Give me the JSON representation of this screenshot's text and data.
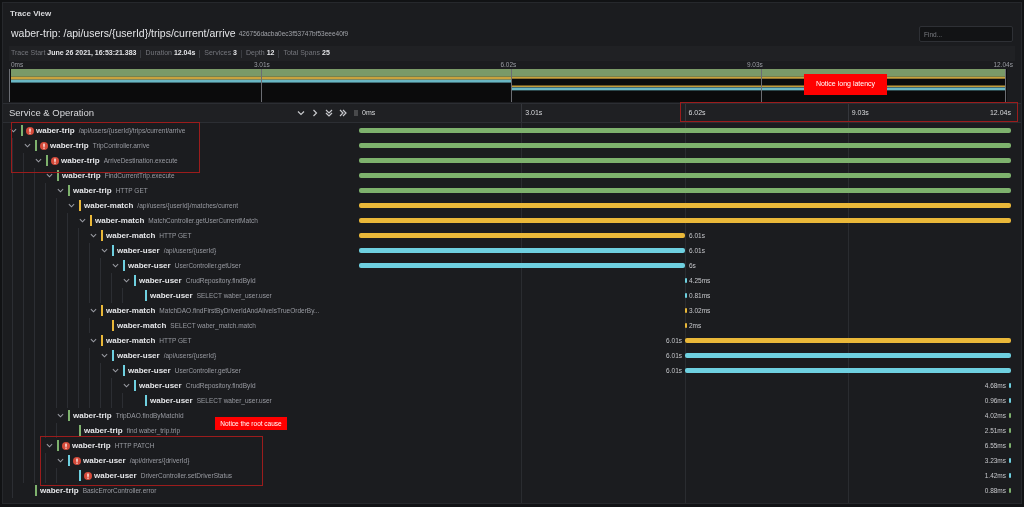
{
  "panel_title": "Trace View",
  "trace": {
    "title": "waber-trip: /api/users/{userId}/trips/current/arrive",
    "trace_id": "426756dacba0ec3f53747bf53eee40f9"
  },
  "find": {
    "placeholder": "Find..."
  },
  "meta": [
    {
      "label": "Trace Start",
      "value": "June 26 2021, 16:53:21.383"
    },
    {
      "label": "Duration",
      "value": "12.04s"
    },
    {
      "label": "Services",
      "value": "3"
    },
    {
      "label": "Depth",
      "value": "12"
    },
    {
      "label": "Total Spans",
      "value": "25"
    }
  ],
  "minimap": {
    "ticks": [
      "0ms",
      "3.01s",
      "6.02s",
      "9.03s",
      "12.04s"
    ]
  },
  "annotations": [
    {
      "text": "Notice long latency"
    },
    {
      "text": "Notice the root cause"
    }
  ],
  "columns": {
    "title": "Service & Operation",
    "ticks": [
      "0ms",
      "3.01s",
      "6.02s",
      "9.03s",
      "12.04s"
    ]
  },
  "spans": [
    {
      "service": "waber-trip",
      "operation": "/api/users/{userId}/trips/current/arrive",
      "error": true,
      "expanded": true,
      "color": "#7eb26d",
      "kind": "full",
      "children": [
        {
          "service": "waber-trip",
          "operation": "TripController.arrive",
          "error": true,
          "expanded": true,
          "color": "#7eb26d",
          "kind": "full",
          "children": [
            {
              "service": "waber-trip",
              "operation": "ArriveDestination.execute",
              "error": true,
              "expanded": true,
              "color": "#7eb26d",
              "kind": "full",
              "children": [
                {
                  "service": "waber-trip",
                  "operation": "FindCurrentTrip.execute",
                  "error": false,
                  "expanded": true,
                  "color": "#7eb26d",
                  "kind": "full",
                  "children": [
                    {
                      "service": "waber-trip",
                      "operation": "HTTP GET",
                      "error": false,
                      "expanded": true,
                      "color": "#7eb26d",
                      "kind": "full",
                      "children": [
                        {
                          "service": "waber-match",
                          "operation": "/api/users/{userId}/matches/current",
                          "error": false,
                          "expanded": true,
                          "color": "#eab839",
                          "kind": "full",
                          "children": [
                            {
                              "service": "waber-match",
                              "operation": "MatchController.getUserCurrentMatch",
                              "error": false,
                              "expanded": true,
                              "color": "#eab839",
                              "kind": "full",
                              "children": [
                                {
                                  "service": "waber-match",
                                  "operation": "HTTP GET",
                                  "error": false,
                                  "expanded": true,
                                  "color": "#eab839",
                                  "kind": "early",
                                  "duration": "6.01s",
                                  "children": [
                                    {
                                      "service": "waber-user",
                                      "operation": "/api/users/{userId}",
                                      "error": false,
                                      "expanded": true,
                                      "color": "#6ed0e0",
                                      "kind": "early",
                                      "duration": "6.01s",
                                      "children": [
                                        {
                                          "service": "waber-user",
                                          "operation": "UserController.getUser",
                                          "error": false,
                                          "expanded": true,
                                          "color": "#6ed0e0",
                                          "kind": "early",
                                          "duration": "6s",
                                          "children": [
                                            {
                                              "service": "waber-user",
                                              "operation": "CrudRepository.findById",
                                              "error": false,
                                              "expanded": true,
                                              "color": "#6ed0e0",
                                              "kind": "midtick",
                                              "duration": "4.25ms",
                                              "children": [
                                                {
                                                  "service": "waber-user",
                                                  "operation": "SELECT waber_user.user",
                                                  "error": false,
                                                  "color": "#6ed0e0",
                                                  "kind": "midtick",
                                                  "duration": "0.81ms"
                                                }
                                              ]
                                            }
                                          ]
                                        }
                                      ]
                                    }
                                  ]
                                },
                                {
                                  "service": "waber-match",
                                  "operation": "MatchDAO.findFirstByDriverIdAndAliveIsTrueOrderBy...",
                                  "error": false,
                                  "expanded": true,
                                  "color": "#eab839",
                                  "kind": "midtick",
                                  "duration": "3.02ms",
                                  "children": [
                                    {
                                      "service": "waber-match",
                                      "operation": "SELECT waber_match.match",
                                      "error": false,
                                      "color": "#eab839",
                                      "kind": "midtick",
                                      "duration": "2ms"
                                    }
                                  ]
                                },
                                {
                                  "service": "waber-match",
                                  "operation": "HTTP GET",
                                  "error": false,
                                  "expanded": true,
                                  "color": "#eab839",
                                  "kind": "late",
                                  "duration": "6.01s",
                                  "children": [
                                    {
                                      "service": "waber-user",
                                      "operation": "/api/users/{userId}",
                                      "error": false,
                                      "expanded": true,
                                      "color": "#6ed0e0",
                                      "kind": "late",
                                      "duration": "6.01s",
                                      "children": [
                                        {
                                          "service": "waber-user",
                                          "operation": "UserController.getUser",
                                          "error": false,
                                          "expanded": true,
                                          "color": "#6ed0e0",
                                          "kind": "late",
                                          "duration": "6.01s",
                                          "children": [
                                            {
                                              "service": "waber-user",
                                              "operation": "CrudRepository.findById",
                                              "error": false,
                                              "expanded": true,
                                              "color": "#6ed0e0",
                                              "kind": "endtick",
                                              "duration": "4.68ms",
                                              "children": [
                                                {
                                                  "service": "waber-user",
                                                  "operation": "SELECT waber_user.user",
                                                  "error": false,
                                                  "color": "#6ed0e0",
                                                  "kind": "endtick",
                                                  "duration": "0.96ms"
                                                }
                                              ]
                                            }
                                          ]
                                        }
                                      ]
                                    }
                                  ]
                                }
                              ]
                            }
                          ]
                        }
                      ]
                    },
                    {
                      "service": "waber-trip",
                      "operation": "TripDAO.findByMatchId",
                      "error": false,
                      "expanded": true,
                      "color": "#7eb26d",
                      "kind": "endtick",
                      "duration": "4.02ms",
                      "children": [
                        {
                          "service": "waber-trip",
                          "operation": "find waber_trip.trip",
                          "error": false,
                          "color": "#7eb26d",
                          "kind": "endtick",
                          "duration": "2.51ms"
                        }
                      ]
                    }
                  ]
                },
                {
                  "service": "waber-trip",
                  "operation": "HTTP PATCH",
                  "error": true,
                  "expanded": true,
                  "color": "#7eb26d",
                  "kind": "endtick",
                  "duration": "6.55ms",
                  "children": [
                    {
                      "service": "waber-user",
                      "operation": "/api/drivers/{driverId}",
                      "error": true,
                      "expanded": true,
                      "color": "#6ed0e0",
                      "kind": "endtick",
                      "duration": "3.23ms",
                      "children": [
                        {
                          "service": "waber-user",
                          "operation": "DriverController.setDriverStatus",
                          "error": true,
                          "color": "#6ed0e0",
                          "kind": "endtick",
                          "duration": "1.42ms"
                        }
                      ]
                    }
                  ]
                }
              ]
            }
          ]
        },
        {
          "service": "waber-trip",
          "operation": "BasicErrorController.error",
          "error": false,
          "color": "#7eb26d",
          "kind": "endtick",
          "duration": "0.88ms"
        }
      ]
    }
  ]
}
